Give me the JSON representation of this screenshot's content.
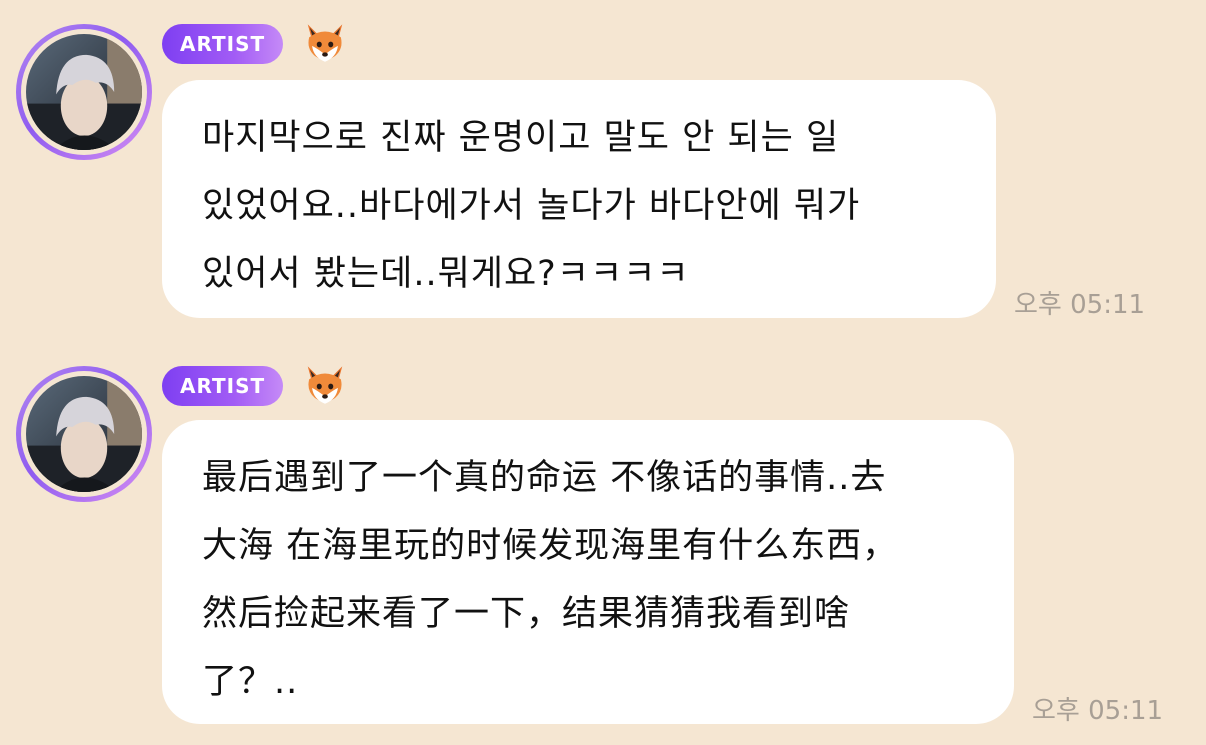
{
  "messages": [
    {
      "badge": "ARTIST",
      "icon": "fox-emoji",
      "lines": [
        "마지막으로 진짜 운명이고 말도 안 되는 일",
        "있었어요..바다에가서 놀다가 바다안에 뭐가",
        "있어서 봤는데..뭐게요?ㅋㅋㅋㅋ"
      ],
      "time": "오후 05:11"
    },
    {
      "badge": "ARTIST",
      "icon": "fox-emoji",
      "lines": [
        "最后遇到了一个真的命运 不像话的事情..去",
        "大海 在海里玩的时候发现海里有什么东西，",
        "然后捡起来看了一下，结果猜猜我看到啥",
        "了？.."
      ],
      "time": "오후 05:11"
    }
  ],
  "colors": {
    "background": "#f5e6d2",
    "badge_start": "#7e3ff2",
    "badge_end": "#c58af7",
    "bubble": "#ffffff",
    "timestamp": "#a89f95"
  }
}
